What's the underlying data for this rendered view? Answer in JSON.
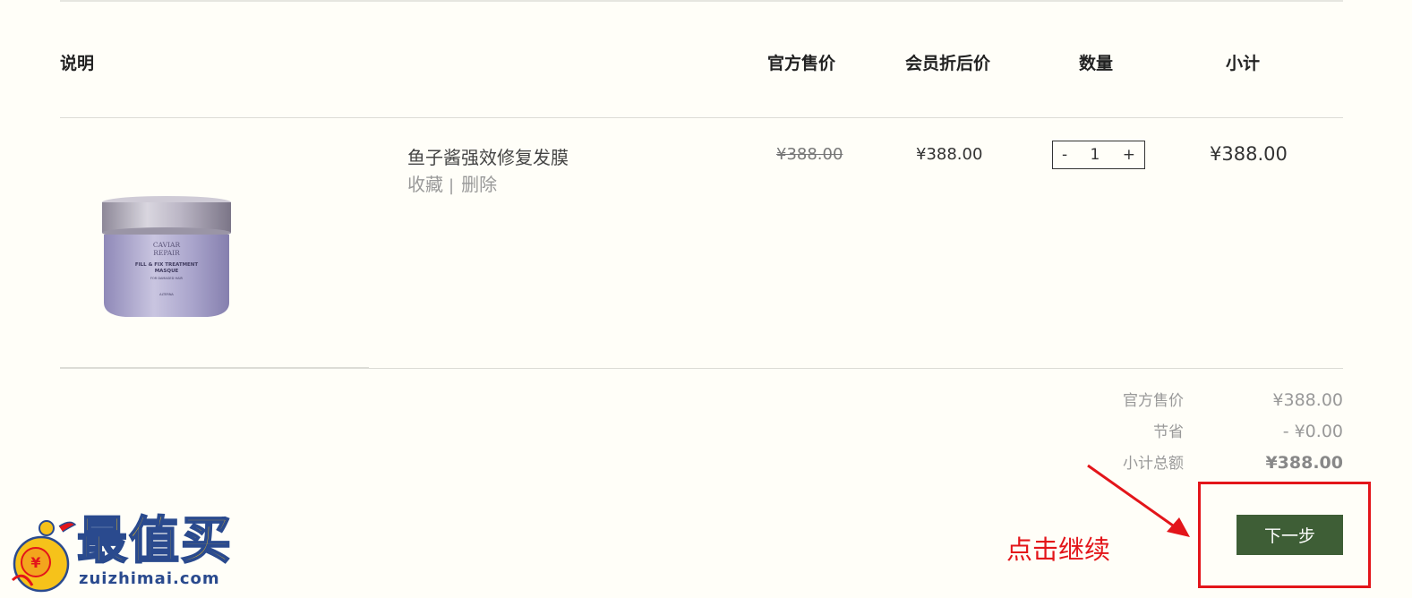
{
  "columns": {
    "description": "说明",
    "msrp": "官方售价",
    "member_price": "会员折后价",
    "quantity": "数量",
    "subtotal": "小计"
  },
  "item": {
    "name": "鱼子酱强效修复发膜",
    "favorite_label": "收藏",
    "separator": "|",
    "delete_label": "删除",
    "msrp": "¥388.00",
    "member_price": "¥388.00",
    "qty_minus": "-",
    "qty_value": "1",
    "qty_plus": "+",
    "subtotal": "¥388.00",
    "thumb_text": {
      "line1": "CAVIAR",
      "line2": "REPAIR",
      "line3": "FILL & FIX TREATMENT",
      "line4": "MASQUE",
      "line5": "FOR DAMAGED HAIR",
      "line6": "ALTERNA"
    }
  },
  "summary": {
    "msrp_label": "官方售价",
    "msrp_value": "¥388.00",
    "savings_label": "节省",
    "savings_value": "- ¥0.00",
    "total_label": "小计总额",
    "total_value": "¥388.00"
  },
  "actions": {
    "next_label": "下一步"
  },
  "annotation": {
    "text": "点击继续",
    "color": "#e3151a"
  },
  "watermark": {
    "title": "最值买",
    "url": "zuizhimai.com"
  },
  "colors": {
    "background": "#fffef8",
    "button": "#3e5e36",
    "annotation_red": "#e3151a"
  }
}
